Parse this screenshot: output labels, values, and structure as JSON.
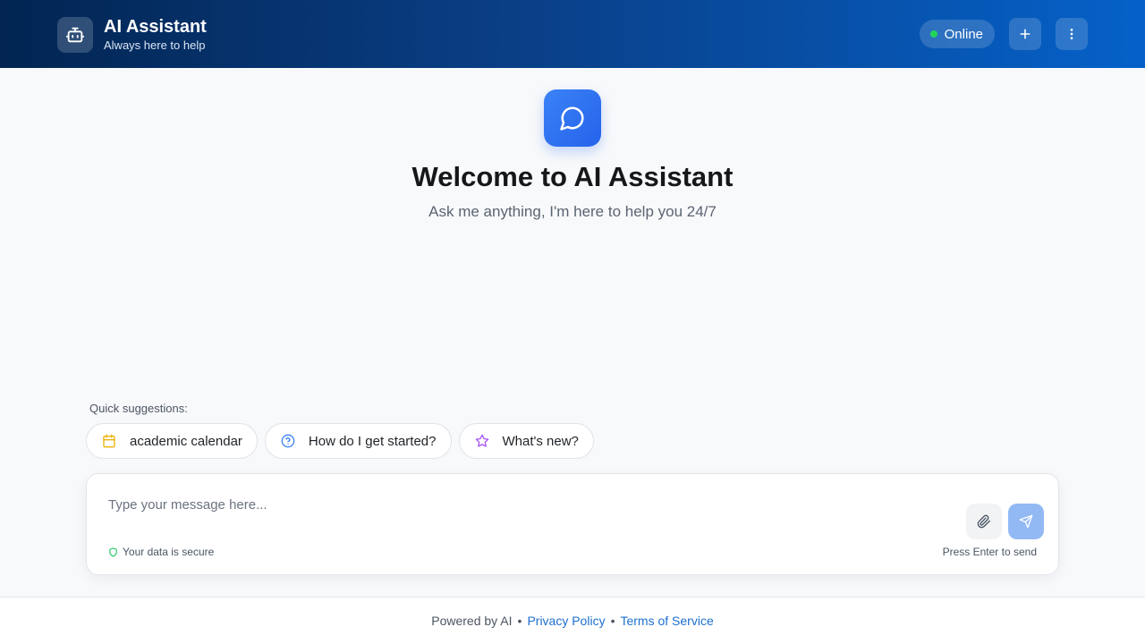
{
  "header": {
    "title": "AI Assistant",
    "subtitle": "Always here to help",
    "status": "Online",
    "status_color": "#22d45a",
    "icons": {
      "brand": "robot-icon",
      "new": "plus-icon",
      "menu": "more-vertical-icon"
    }
  },
  "welcome": {
    "icon": "chat-bubble-icon",
    "title": "Welcome to AI Assistant",
    "subtitle": "Ask me anything, I'm here to help you 24/7"
  },
  "suggestions": {
    "label": "Quick suggestions:",
    "items": [
      {
        "label": "academic calendar",
        "icon": "calendar-icon",
        "color": "#eab308"
      },
      {
        "label": "How do I get started?",
        "icon": "help-circle-icon",
        "color": "#3b82f6"
      },
      {
        "label": "What's new?",
        "icon": "star-icon",
        "color": "#a855f7"
      }
    ]
  },
  "composer": {
    "placeholder": "Type your message here...",
    "value": "",
    "secure_text": "Your data is secure",
    "hint": "Press Enter to send",
    "icons": {
      "attach": "paperclip-icon",
      "send": "send-icon",
      "secure": "shield-icon"
    }
  },
  "footer": {
    "powered": "Powered by AI",
    "privacy": "Privacy Policy",
    "terms": "Terms of Service",
    "separator": "•"
  },
  "colors": {
    "accent": "#2563eb",
    "link": "#1d6fcf"
  }
}
